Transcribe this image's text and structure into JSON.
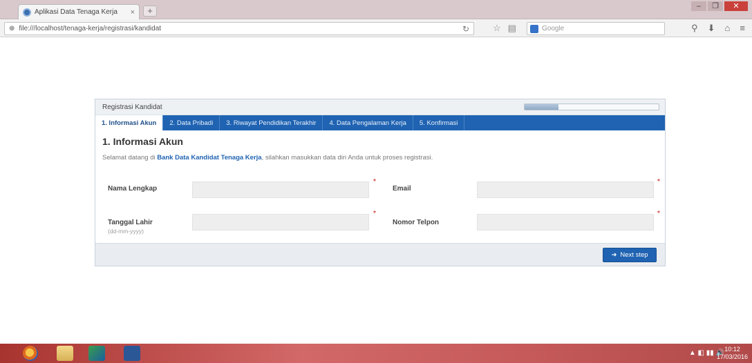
{
  "browser": {
    "tab_title": "Aplikasi Data Tenaga Kerja",
    "tab_close": "×",
    "new_tab": "+",
    "url": "file:///localhost/tenaga-kerja/registrasi/kandidat",
    "reload": "↻",
    "search_placeholder": "Google",
    "window_min": "–",
    "window_max": "❐",
    "window_close": "✕"
  },
  "panel": {
    "header_title": "Registrasi Kandidat",
    "progress": 0.25,
    "tabs": [
      {
        "label": "1. Informasi Akun"
      },
      {
        "label": "2. Data Pribadi"
      },
      {
        "label": "3. Riwayat Pendidikan Terakhir"
      },
      {
        "label": "4. Data Pengalaman Kerja"
      },
      {
        "label": "5. Konfirmasi"
      }
    ],
    "form_title": "1. Informasi Akun",
    "intro_prefix": "Selamat datang di",
    "intro_link": "Bank Data Kandidat Tenaga Kerja",
    "intro_suffix": ", silahkan masukkan data diri Anda untuk proses registrasi.",
    "fields": {
      "nama_label": "Nama Lengkap",
      "email_label": "Email",
      "tanggal_label": "Tanggal Lahir",
      "tanggal_hint": "(dd-mm-yyyy)",
      "telepon_label": "Nomor Telpon"
    },
    "required_mark": "*",
    "next_button": "Next step",
    "next_icon": "➜"
  },
  "taskbar": {
    "tray": "▲  ◧  ▮▮  🔊",
    "time": "10:12",
    "date": "17/03/2016"
  }
}
